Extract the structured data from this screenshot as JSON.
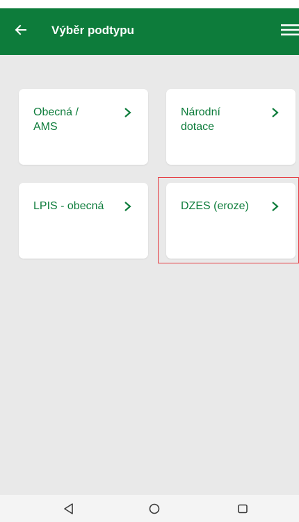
{
  "app_bar": {
    "title": "Výběr podtypu",
    "back_icon": "arrow-left-icon",
    "menu_icon": "hamburger-menu-icon",
    "color": "#0d7c3b"
  },
  "cards": [
    {
      "label_line1": "Obecná /",
      "label_line2": "AMS"
    },
    {
      "label_line1": "Národní",
      "label_line2": "dotace"
    },
    {
      "label_line1": "LPIS - obecná",
      "label_line2": ""
    },
    {
      "label_line1": "DZES (eroze)",
      "label_line2": ""
    }
  ],
  "card_chevron_icon": "chevron-right-icon",
  "highlight_color": "#e5393f",
  "nav_bar": {
    "back_icon": "triangle-back-icon",
    "home_icon": "circle-home-icon",
    "recents_icon": "square-recents-icon"
  }
}
